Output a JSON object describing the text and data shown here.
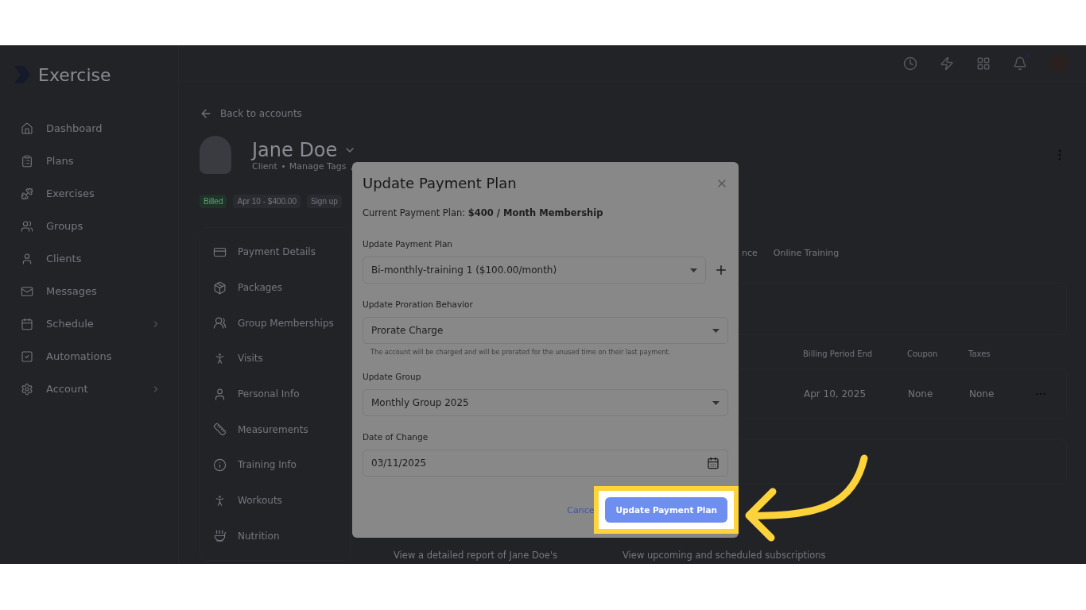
{
  "app": {
    "logo": "Exercise"
  },
  "sidebar": {
    "items": [
      {
        "label": "Dashboard",
        "expandable": false
      },
      {
        "label": "Plans",
        "expandable": false
      },
      {
        "label": "Exercises",
        "expandable": false
      },
      {
        "label": "Groups",
        "expandable": false
      },
      {
        "label": "Clients",
        "expandable": false
      },
      {
        "label": "Messages",
        "expandable": false
      },
      {
        "label": "Schedule",
        "expandable": true
      },
      {
        "label": "Automations",
        "expandable": false
      },
      {
        "label": "Account",
        "expandable": true
      }
    ]
  },
  "topbar": {
    "notification_dot": true
  },
  "back_link": "Back to accounts",
  "profile": {
    "name": "Jane Doe",
    "role": "Client",
    "tags_link": "Manage Tags"
  },
  "chips": [
    {
      "label": "Billed",
      "kind": "status"
    },
    {
      "label": "Apr 10 - $400.00",
      "kind": "plain"
    },
    {
      "label": "Sign up",
      "kind": "plain"
    }
  ],
  "account_nav": [
    "Payment Details",
    "Packages",
    "Group Memberships",
    "Visits",
    "Personal Info",
    "Measurements",
    "Training Info",
    "Workouts",
    "Nutrition"
  ],
  "tabs": [
    "nce",
    "Online Training"
  ],
  "table": {
    "columns": [
      "Billing Period End",
      "Coupon",
      "Taxes"
    ],
    "rows": [
      [
        "Apr 10, 2025",
        "None",
        "None"
      ]
    ]
  },
  "cards": [
    "View a detailed report of Jane Doe's",
    "View upcoming and scheduled subscriptions"
  ],
  "modal": {
    "title": "Update Payment Plan",
    "current_plan": "Current Payment Plan: **$400 / Month Membership**",
    "fields": [
      {
        "label": "Update Payment Plan",
        "value": "Bi-monthly-training 1 ($100.00/month)",
        "kind": "select",
        "addable": true
      },
      {
        "label": "Update Proration Behavior",
        "value": "Prorate Charge",
        "kind": "select",
        "addable": false,
        "hint": "The account will be charged and will be prorated for the unused time on their last payment."
      },
      {
        "label": "Update Group",
        "value": "Monthly Group 2025",
        "kind": "select",
        "addable": false
      },
      {
        "label": "Date of Change",
        "value": "03/11/2025",
        "kind": "date",
        "addable": false
      }
    ],
    "cancel": "Cance",
    "submit": "Update Payment Plan",
    "submit_highlighted": true
  }
}
